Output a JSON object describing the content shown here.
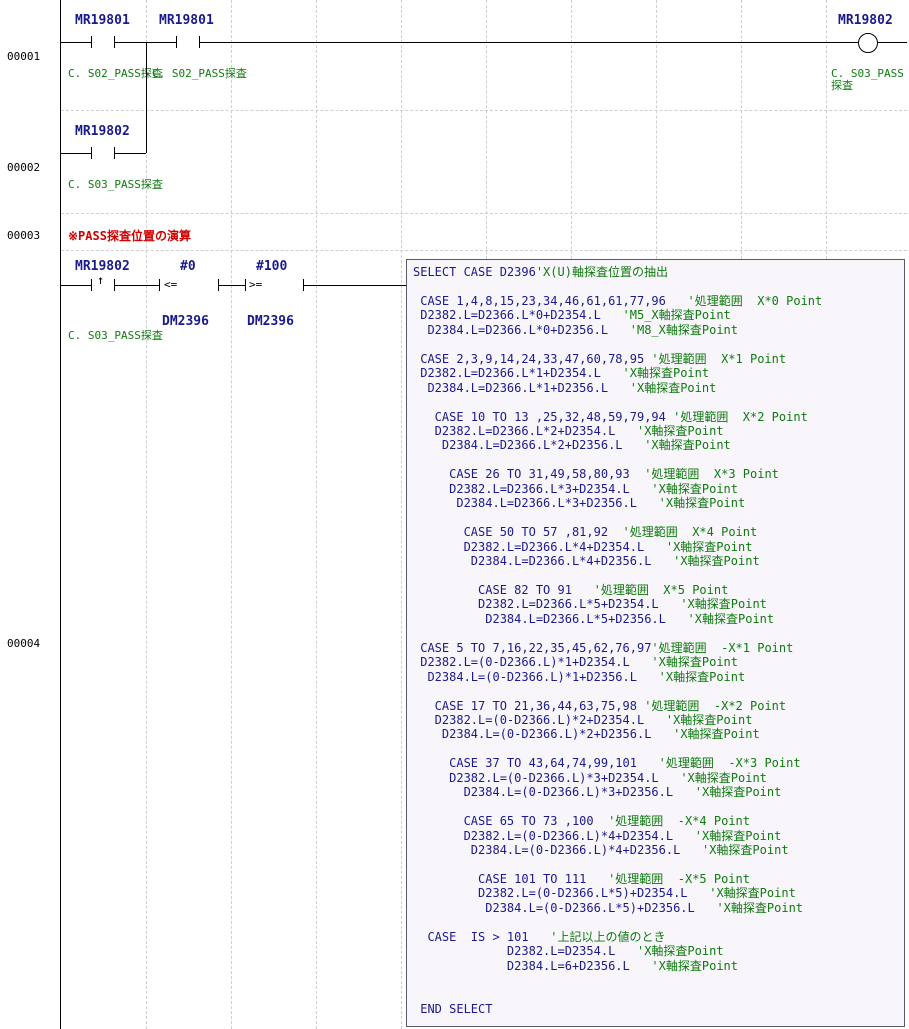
{
  "steps": [
    "00001",
    "00002",
    "00003",
    "00004"
  ],
  "rung1": {
    "contact1": {
      "device": "MR19801",
      "comment": "C.\nS02_PASS探査"
    },
    "contact2": {
      "device": "MR19801",
      "comment": "C.\nS02_PASS探査"
    },
    "coil": {
      "device": "MR19802",
      "comment": "C.\nS03_PASS探査"
    }
  },
  "rung2": {
    "contact1": {
      "device": "MR19802",
      "comment": "C.\nS03_PASS探査"
    }
  },
  "rung3": {
    "remark": "※PASS探査位置の演算"
  },
  "rung4": {
    "contact1": {
      "device": "MR19802",
      "comment": "C.\nS03_PASS探査"
    },
    "compare1": {
      "operand1": "#0",
      "operator": "<=",
      "operand2": "DM2396"
    },
    "compare2": {
      "operand1": "#100",
      "operator": ">=",
      "operand2": "DM2396"
    }
  },
  "script": [
    {
      "code": "SELECT CASE D2396",
      "comment": "'X(U)軸探査位置の抽出"
    },
    {
      "code": "",
      "comment": ""
    },
    {
      "code": " CASE 1,4,8,15,23,34,46,61,61,77,96",
      "comment": "   '処理範囲  X*0 Point"
    },
    {
      "code": " D2382.L=D2366.L*0+D2354.L",
      "comment": "   'M5_X軸探査Point"
    },
    {
      "code": "  D2384.L=D2366.L*0+D2356.L",
      "comment": "   'M8_X軸探査Point"
    },
    {
      "code": "",
      "comment": ""
    },
    {
      "code": " CASE 2,3,9,14,24,33,47,60,78,95",
      "comment": " '処理範囲  X*1 Point"
    },
    {
      "code": " D2382.L=D2366.L*1+D2354.L",
      "comment": "   'X軸探査Point"
    },
    {
      "code": "  D2384.L=D2366.L*1+D2356.L",
      "comment": "   'X軸探査Point"
    },
    {
      "code": "",
      "comment": ""
    },
    {
      "code": "   CASE 10 TO 13 ,25,32,48,59,79,94",
      "comment": " '処理範囲  X*2 Point"
    },
    {
      "code": "   D2382.L=D2366.L*2+D2354.L",
      "comment": "   'X軸探査Point"
    },
    {
      "code": "    D2384.L=D2366.L*2+D2356.L",
      "comment": "   'X軸探査Point"
    },
    {
      "code": "",
      "comment": ""
    },
    {
      "code": "     CASE 26 TO 31,49,58,80,93",
      "comment": "  '処理範囲  X*3 Point"
    },
    {
      "code": "     D2382.L=D2366.L*3+D2354.L",
      "comment": "   'X軸探査Point"
    },
    {
      "code": "      D2384.L=D2366.L*3+D2356.L",
      "comment": "   'X軸探査Point"
    },
    {
      "code": "",
      "comment": ""
    },
    {
      "code": "       CASE 50 TO 57 ,81,92",
      "comment": "  '処理範囲  X*4 Point"
    },
    {
      "code": "       D2382.L=D2366.L*4+D2354.L",
      "comment": "   'X軸探査Point"
    },
    {
      "code": "        D2384.L=D2366.L*4+D2356.L",
      "comment": "   'X軸探査Point"
    },
    {
      "code": "",
      "comment": ""
    },
    {
      "code": "         CASE 82 TO 91",
      "comment": "   '処理範囲  X*5 Point"
    },
    {
      "code": "         D2382.L=D2366.L*5+D2354.L",
      "comment": "   'X軸探査Point"
    },
    {
      "code": "          D2384.L=D2366.L*5+D2356.L",
      "comment": "   'X軸探査Point"
    },
    {
      "code": "",
      "comment": ""
    },
    {
      "code": " CASE 5 TO 7,16,22,35,45,62,76,97",
      "comment": "'処理範囲  -X*1 Point"
    },
    {
      "code": " D2382.L=(0-D2366.L)*1+D2354.L",
      "comment": "   'X軸探査Point"
    },
    {
      "code": "  D2384.L=(0-D2366.L)*1+D2356.L",
      "comment": "   'X軸探査Point"
    },
    {
      "code": "",
      "comment": ""
    },
    {
      "code": "   CASE 17 TO 21,36,44,63,75,98",
      "comment": " '処理範囲  -X*2 Point"
    },
    {
      "code": "   D2382.L=(0-D2366.L)*2+D2354.L",
      "comment": "   'X軸探査Point"
    },
    {
      "code": "    D2384.L=(0-D2366.L)*2+D2356.L",
      "comment": "   'X軸探査Point"
    },
    {
      "code": "",
      "comment": ""
    },
    {
      "code": "     CASE 37 TO 43,64,74,99,101",
      "comment": "   '処理範囲  -X*3 Point"
    },
    {
      "code": "     D2382.L=(0-D2366.L)*3+D2354.L",
      "comment": "   'X軸探査Point"
    },
    {
      "code": "       D2384.L=(0-D2366.L)*3+D2356.L",
      "comment": "   'X軸探査Point"
    },
    {
      "code": "",
      "comment": ""
    },
    {
      "code": "       CASE 65 TO 73 ,100",
      "comment": "  '処理範囲  -X*4 Point"
    },
    {
      "code": "       D2382.L=(0-D2366.L)*4+D2354.L",
      "comment": "   'X軸探査Point"
    },
    {
      "code": "        D2384.L=(0-D2366.L)*4+D2356.L",
      "comment": "   'X軸探査Point"
    },
    {
      "code": "",
      "comment": ""
    },
    {
      "code": "         CASE 101 TO 111",
      "comment": "   '処理範囲  -X*5 Point"
    },
    {
      "code": "         D2382.L=(0-D2366.L*5)+D2354.L",
      "comment": "   'X軸探査Point"
    },
    {
      "code": "          D2384.L=(0-D2366.L*5)+D2356.L",
      "comment": "   'X軸探査Point"
    },
    {
      "code": "",
      "comment": ""
    },
    {
      "code": "  CASE  IS > 101",
      "comment": "   '上記以上の値のとき"
    },
    {
      "code": "             D2382.L=D2354.L",
      "comment": "   'X軸探査Point"
    },
    {
      "code": "             D2384.L=6+D2356.L",
      "comment": "   'X軸探査Point"
    },
    {
      "code": "",
      "comment": ""
    },
    {
      "code": "",
      "comment": ""
    },
    {
      "code": " END SELECT",
      "comment": ""
    }
  ]
}
